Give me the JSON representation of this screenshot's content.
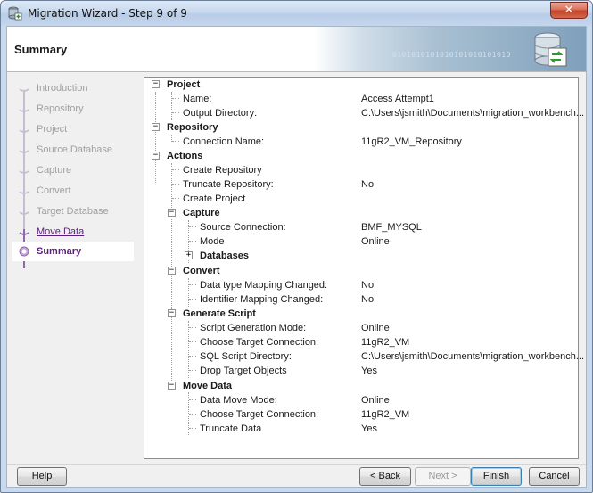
{
  "window": {
    "title": "Migration Wizard - Step 9 of 9",
    "close_glyph": "✕"
  },
  "header": {
    "title": "Summary",
    "banner_text": "0101010101010101010101010"
  },
  "nav": {
    "items": [
      {
        "label": "Introduction",
        "state": "done"
      },
      {
        "label": "Repository",
        "state": "done"
      },
      {
        "label": "Project",
        "state": "done"
      },
      {
        "label": "Source Database",
        "state": "done"
      },
      {
        "label": "Capture",
        "state": "done"
      },
      {
        "label": "Convert",
        "state": "done"
      },
      {
        "label": "Target Database",
        "state": "done"
      },
      {
        "label": "Move Data",
        "state": "link"
      },
      {
        "label": "Summary",
        "state": "current"
      }
    ]
  },
  "tree": {
    "project": {
      "label": "Project",
      "name_label": "Name:",
      "name_value": "Access Attempt1",
      "outdir_label": "Output Directory:",
      "outdir_value": "C:\\Users\\jsmith\\Documents\\migration_workbench..."
    },
    "repository": {
      "label": "Repository",
      "conn_label": "Connection Name:",
      "conn_value": "11gR2_VM_Repository"
    },
    "actions": {
      "label": "Actions",
      "create_repo": "Create Repository",
      "truncate_label": "Truncate Repository:",
      "truncate_value": "No",
      "create_project": "Create Project",
      "capture": {
        "label": "Capture",
        "src_label": "Source Connection:",
        "src_value": "BMF_MYSQL",
        "mode_label": "Mode",
        "mode_value": "Online",
        "databases_label": "Databases"
      },
      "convert": {
        "label": "Convert",
        "dtype_label": "Data type Mapping Changed:",
        "dtype_value": "No",
        "ident_label": "Identifier Mapping Changed:",
        "ident_value": "No"
      },
      "generate": {
        "label": "Generate Script",
        "mode_label": "Script Generation Mode:",
        "mode_value": "Online",
        "target_label": "Choose Target Connection:",
        "target_value": "11gR2_VM",
        "sqldir_label": "SQL Script Directory:",
        "sqldir_value": "C:\\Users\\jsmith\\Documents\\migration_workbench...",
        "drop_label": "Drop Target Objects",
        "drop_value": "Yes"
      },
      "move": {
        "label": "Move Data",
        "mode_label": "Data Move Mode:",
        "mode_value": "Online",
        "target_label": "Choose Target Connection:",
        "target_value": "11gR2_VM",
        "truncate_label": "Truncate Data",
        "truncate_value": "Yes"
      }
    }
  },
  "buttons": {
    "help": "Help",
    "back": "< Back",
    "next": "Next >",
    "finish": "Finish",
    "cancel": "Cancel"
  },
  "glyphs": {
    "minus": "−",
    "plus": "+"
  },
  "colors": {
    "accent": "#5a1f7a",
    "nav_disabled": "#a0a0a0"
  }
}
